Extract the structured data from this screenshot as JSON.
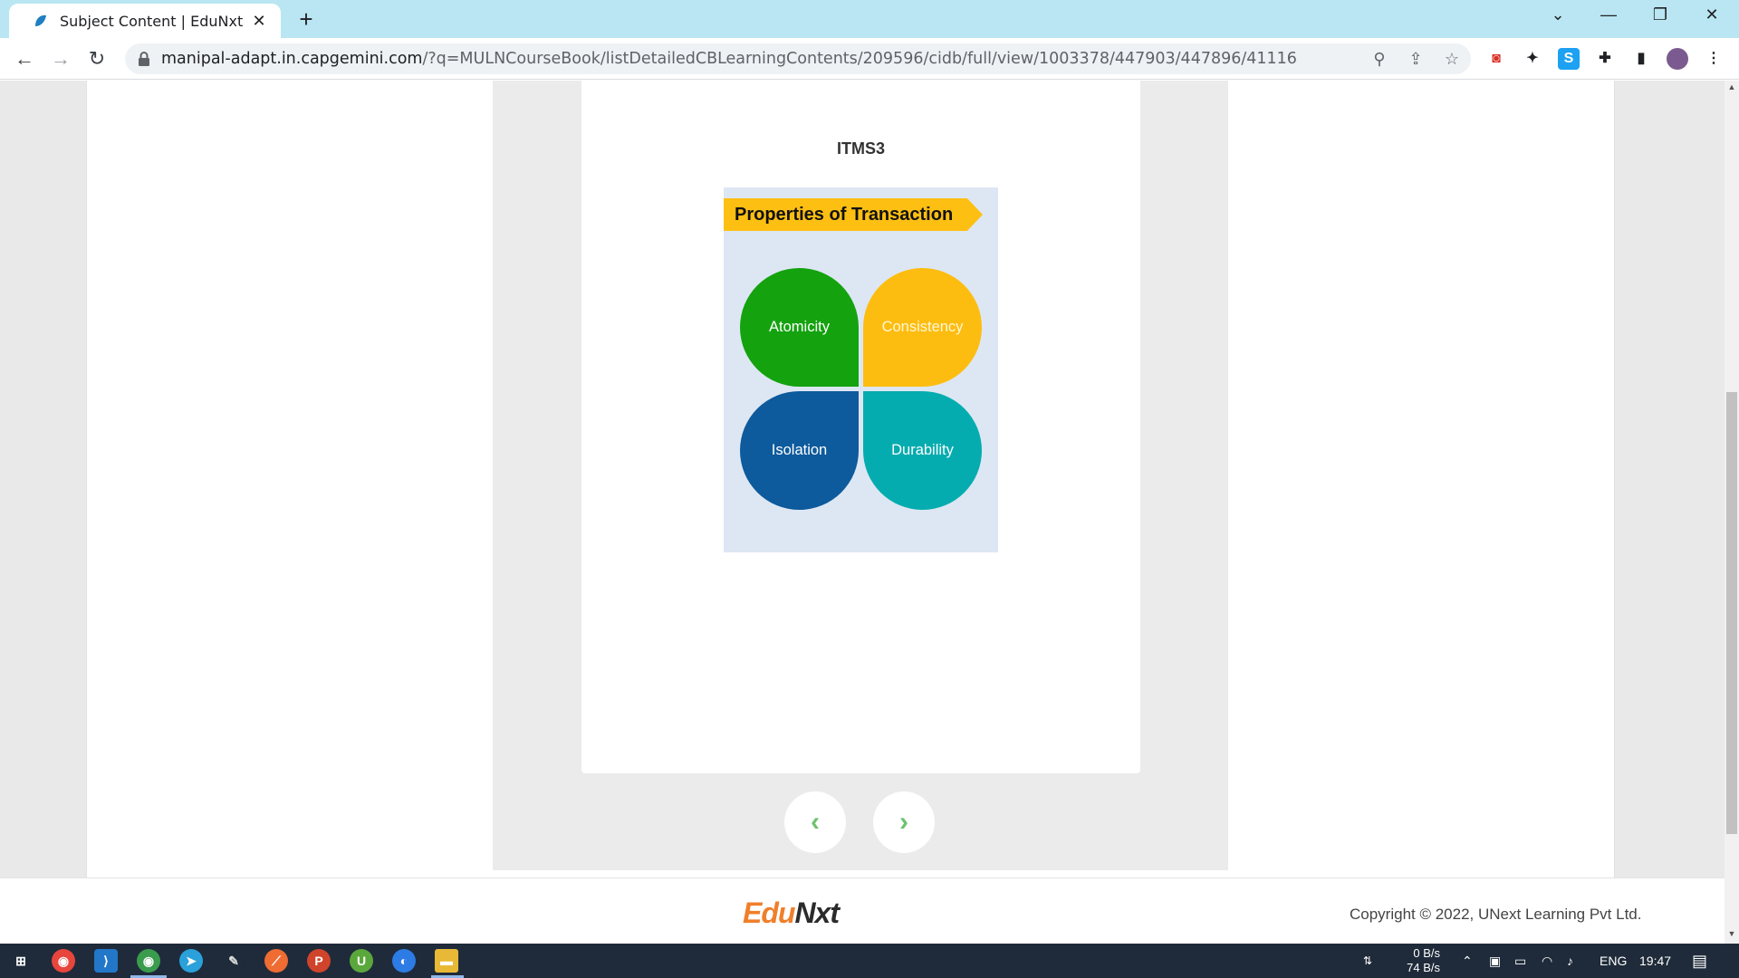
{
  "browser": {
    "tab_title": "Subject Content | EduNxt",
    "tab_close": "✕",
    "new_tab": "+",
    "url_domain": "manipal-adapt.in.capgemini.com",
    "url_path": "/?q=MULNCourseBook/listDetailedCBLearningContents/209596/cidb/full/view/1003378/447903/447896/41116",
    "nav": {
      "back": "←",
      "forward": "→",
      "reload": "↻"
    }
  },
  "slide": {
    "title": "ITMS3",
    "figure": {
      "banner": "Properties of Transaction",
      "petals": [
        "Atomicity",
        "Consistency",
        "Isolation",
        "Durability"
      ]
    }
  },
  "pager": {
    "prev": "‹",
    "next": "›"
  },
  "footer": {
    "logo_edu": "Edu",
    "logo_nxt": "Nxt",
    "copyright": "Copyright © 2022, UNext Learning Pvt Ltd."
  },
  "taskbar": {
    "net_up": "0 B/s",
    "net_down": "74 B/s",
    "language": "ENG",
    "time": "19:47"
  },
  "colors": {
    "atomicity": "#14a20f",
    "consistency": "#fdbd10",
    "isolation": "#0d5a9c",
    "durability": "#05acaf",
    "banner": "#fdbf12",
    "pager_arrow": "#6cc26e"
  }
}
